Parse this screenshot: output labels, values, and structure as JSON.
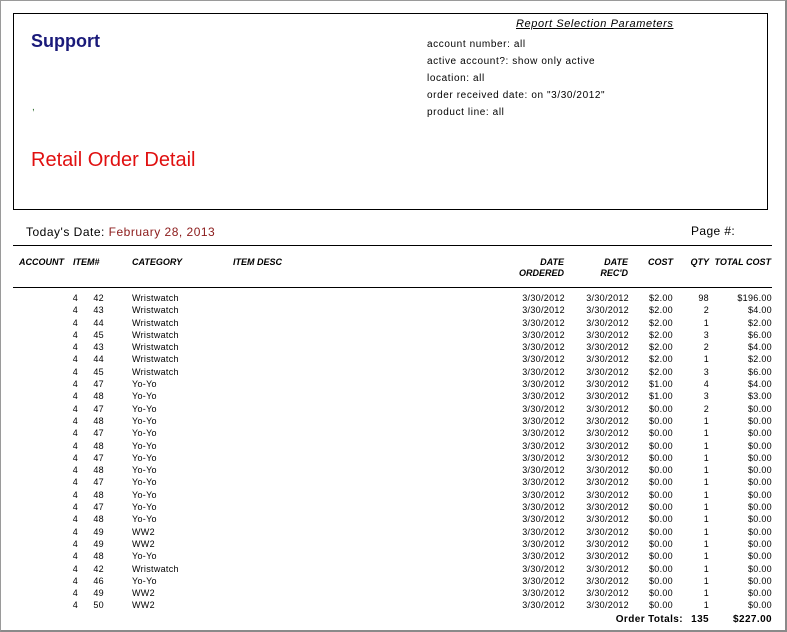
{
  "header": {
    "company": "Support",
    "comma": ",",
    "report_title": "Retail Order Detail",
    "params_title": "Report Selection Parameters",
    "params": [
      "account number: all",
      "active account?: show only active",
      "location: all",
      "order received date: on \"3/30/2012\"",
      "product line: all"
    ]
  },
  "today_label": "Today's Date:",
  "today_date": "February 28, 2013",
  "page_label": "Page #:",
  "columns": {
    "account": "ACCOUNT",
    "item": "ITEM#",
    "category": "CATEGORY",
    "item_desc": "ITEM DESC",
    "date_ordered_1": "DATE",
    "date_ordered_2": "ORDERED",
    "date_recd_1": "DATE",
    "date_recd_2": "REC'D",
    "cost": "COST",
    "qty": "QTY",
    "total_cost": "TOTAL COST"
  },
  "rows": [
    {
      "account": "4",
      "item": "42",
      "category": "Wristwatch",
      "ordered": "3/30/2012",
      "recd": "3/30/2012",
      "cost": "$2.00",
      "qty": "98",
      "total": "$196.00"
    },
    {
      "account": "4",
      "item": "43",
      "category": "Wristwatch",
      "ordered": "3/30/2012",
      "recd": "3/30/2012",
      "cost": "$2.00",
      "qty": "2",
      "total": "$4.00"
    },
    {
      "account": "4",
      "item": "44",
      "category": "Wristwatch",
      "ordered": "3/30/2012",
      "recd": "3/30/2012",
      "cost": "$2.00",
      "qty": "1",
      "total": "$2.00"
    },
    {
      "account": "4",
      "item": "45",
      "category": "Wristwatch",
      "ordered": "3/30/2012",
      "recd": "3/30/2012",
      "cost": "$2.00",
      "qty": "3",
      "total": "$6.00"
    },
    {
      "account": "4",
      "item": "43",
      "category": "Wristwatch",
      "ordered": "3/30/2012",
      "recd": "3/30/2012",
      "cost": "$2.00",
      "qty": "2",
      "total": "$4.00"
    },
    {
      "account": "4",
      "item": "44",
      "category": "Wristwatch",
      "ordered": "3/30/2012",
      "recd": "3/30/2012",
      "cost": "$2.00",
      "qty": "1",
      "total": "$2.00"
    },
    {
      "account": "4",
      "item": "45",
      "category": "Wristwatch",
      "ordered": "3/30/2012",
      "recd": "3/30/2012",
      "cost": "$2.00",
      "qty": "3",
      "total": "$6.00"
    },
    {
      "account": "4",
      "item": "47",
      "category": "Yo-Yo",
      "ordered": "3/30/2012",
      "recd": "3/30/2012",
      "cost": "$1.00",
      "qty": "4",
      "total": "$4.00"
    },
    {
      "account": "4",
      "item": "48",
      "category": "Yo-Yo",
      "ordered": "3/30/2012",
      "recd": "3/30/2012",
      "cost": "$1.00",
      "qty": "3",
      "total": "$3.00"
    },
    {
      "account": "4",
      "item": "47",
      "category": "Yo-Yo",
      "ordered": "3/30/2012",
      "recd": "3/30/2012",
      "cost": "$0.00",
      "qty": "2",
      "total": "$0.00"
    },
    {
      "account": "4",
      "item": "48",
      "category": "Yo-Yo",
      "ordered": "3/30/2012",
      "recd": "3/30/2012",
      "cost": "$0.00",
      "qty": "1",
      "total": "$0.00"
    },
    {
      "account": "4",
      "item": "47",
      "category": "Yo-Yo",
      "ordered": "3/30/2012",
      "recd": "3/30/2012",
      "cost": "$0.00",
      "qty": "1",
      "total": "$0.00"
    },
    {
      "account": "4",
      "item": "48",
      "category": "Yo-Yo",
      "ordered": "3/30/2012",
      "recd": "3/30/2012",
      "cost": "$0.00",
      "qty": "1",
      "total": "$0.00"
    },
    {
      "account": "4",
      "item": "47",
      "category": "Yo-Yo",
      "ordered": "3/30/2012",
      "recd": "3/30/2012",
      "cost": "$0.00",
      "qty": "1",
      "total": "$0.00"
    },
    {
      "account": "4",
      "item": "48",
      "category": "Yo-Yo",
      "ordered": "3/30/2012",
      "recd": "3/30/2012",
      "cost": "$0.00",
      "qty": "1",
      "total": "$0.00"
    },
    {
      "account": "4",
      "item": "47",
      "category": "Yo-Yo",
      "ordered": "3/30/2012",
      "recd": "3/30/2012",
      "cost": "$0.00",
      "qty": "1",
      "total": "$0.00"
    },
    {
      "account": "4",
      "item": "48",
      "category": "Yo-Yo",
      "ordered": "3/30/2012",
      "recd": "3/30/2012",
      "cost": "$0.00",
      "qty": "1",
      "total": "$0.00"
    },
    {
      "account": "4",
      "item": "47",
      "category": "Yo-Yo",
      "ordered": "3/30/2012",
      "recd": "3/30/2012",
      "cost": "$0.00",
      "qty": "1",
      "total": "$0.00"
    },
    {
      "account": "4",
      "item": "48",
      "category": "Yo-Yo",
      "ordered": "3/30/2012",
      "recd": "3/30/2012",
      "cost": "$0.00",
      "qty": "1",
      "total": "$0.00"
    },
    {
      "account": "4",
      "item": "49",
      "category": "WW2",
      "ordered": "3/30/2012",
      "recd": "3/30/2012",
      "cost": "$0.00",
      "qty": "1",
      "total": "$0.00"
    },
    {
      "account": "4",
      "item": "49",
      "category": "WW2",
      "ordered": "3/30/2012",
      "recd": "3/30/2012",
      "cost": "$0.00",
      "qty": "1",
      "total": "$0.00"
    },
    {
      "account": "4",
      "item": "48",
      "category": "Yo-Yo",
      "ordered": "3/30/2012",
      "recd": "3/30/2012",
      "cost": "$0.00",
      "qty": "1",
      "total": "$0.00"
    },
    {
      "account": "4",
      "item": "42",
      "category": "Wristwatch",
      "ordered": "3/30/2012",
      "recd": "3/30/2012",
      "cost": "$0.00",
      "qty": "1",
      "total": "$0.00"
    },
    {
      "account": "4",
      "item": "46",
      "category": "Yo-Yo",
      "ordered": "3/30/2012",
      "recd": "3/30/2012",
      "cost": "$0.00",
      "qty": "1",
      "total": "$0.00"
    },
    {
      "account": "4",
      "item": "49",
      "category": "WW2",
      "ordered": "3/30/2012",
      "recd": "3/30/2012",
      "cost": "$0.00",
      "qty": "1",
      "total": "$0.00"
    },
    {
      "account": "4",
      "item": "50",
      "category": "WW2",
      "ordered": "3/30/2012",
      "recd": "3/30/2012",
      "cost": "$0.00",
      "qty": "1",
      "total": "$0.00"
    }
  ],
  "totals": {
    "label": "Order Totals:",
    "qty": "135",
    "total": "$227.00"
  }
}
